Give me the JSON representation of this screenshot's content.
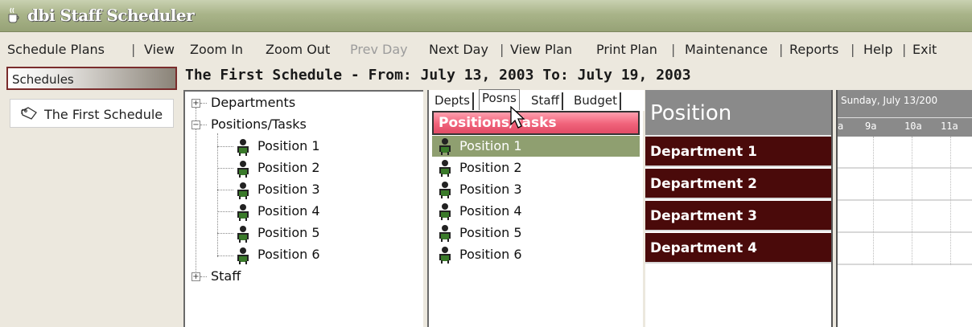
{
  "window": {
    "title": "dbi Staff Scheduler",
    "icon": "coffee-cup-icon"
  },
  "menu": {
    "schedule_plans": "Schedule Plans",
    "view": "View",
    "zoom_in": "Zoom In",
    "zoom_out": "Zoom Out",
    "prev_day": "Prev Day",
    "next_day": "Next Day",
    "view_plan": "View Plan",
    "print_plan": "Print Plan",
    "maintenance": "Maintenance",
    "reports": "Reports",
    "help": "Help",
    "exit": "Exit",
    "separator": "|"
  },
  "schedules": {
    "header": "Schedules",
    "items": [
      {
        "label": "The First Schedule",
        "icon": "schedule-tag-icon"
      }
    ]
  },
  "plan_title": "The First Schedule - From: July 13, 2003 To: July 19, 2003",
  "tree": {
    "departments": "Departments",
    "positions_tasks": "Positions/Tasks",
    "positions": [
      "Position 1",
      "Position 2",
      "Position 3",
      "Position 4",
      "Position 5",
      "Position 6"
    ],
    "staff": "Staff",
    "expand_symbol": "+",
    "collapse_symbol": "−"
  },
  "tabs": [
    "Depts",
    "Posns",
    "Staff",
    "Budget"
  ],
  "active_tab": "Posns",
  "positions_panel": {
    "header": "Positions/Tasks",
    "items": [
      "Position 1",
      "Position 2",
      "Position 3",
      "Position 4",
      "Position 5",
      "Position 6"
    ],
    "selected": "Position 1"
  },
  "grid": {
    "column_header": "Position",
    "departments": [
      "Department 1",
      "Department 2",
      "Department 3",
      "Department 4"
    ],
    "date_label": "Sunday, July 13/200",
    "hours": [
      "a",
      "9a",
      "10a",
      "11a"
    ]
  },
  "colors": {
    "titlebar": "#a9b489",
    "department_bg": "#4a0a0a",
    "positions_header": "#f0627a",
    "selected_row": "#8f9f70",
    "column_header": "#8a8a8a"
  }
}
